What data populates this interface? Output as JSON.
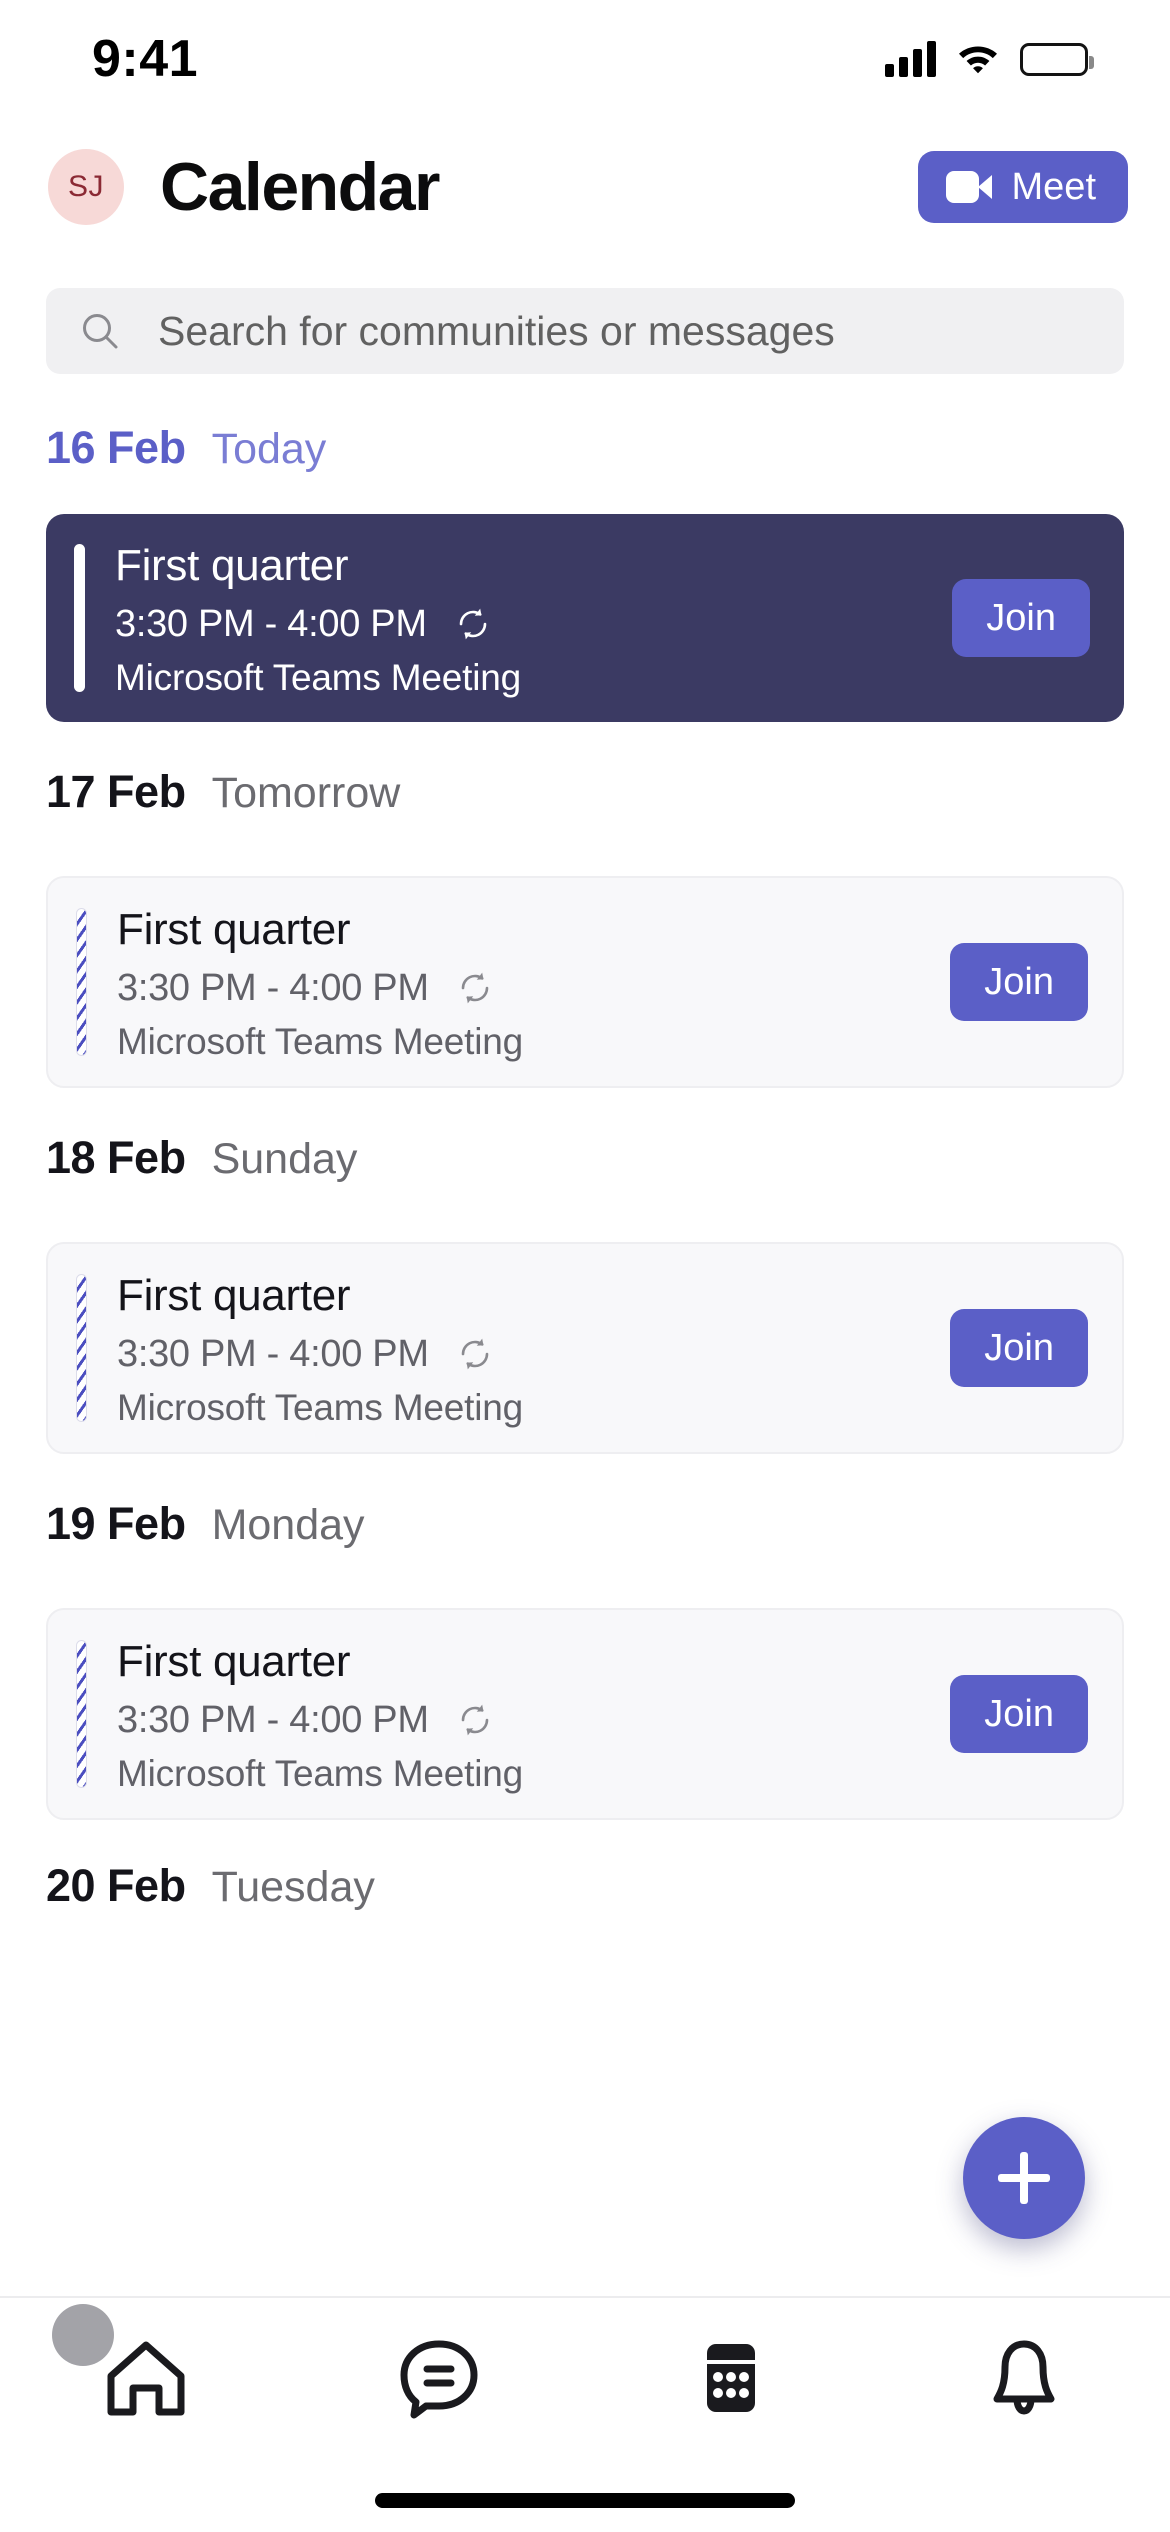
{
  "status_bar": {
    "time": "9:41",
    "signal_icon": "cellular-signal-icon",
    "wifi_icon": "wifi-icon",
    "battery_icon": "battery-full-icon"
  },
  "header": {
    "avatar_initials": "SJ",
    "title": "Calendar",
    "meet_button": {
      "label": "Meet",
      "icon": "video-camera-icon"
    }
  },
  "search": {
    "placeholder": "Search for communities or messages",
    "value": "",
    "icon": "search-icon"
  },
  "colors": {
    "accent": "#5B5FC7",
    "highlight_card_bg": "#3B3A63",
    "card_bg": "#F8F8FA",
    "today_text": "#5B5FC7",
    "muted_text": "#6B6B70",
    "avatar_bg": "#F7D9D7",
    "avatar_text": "#8B2A34"
  },
  "days": [
    {
      "date": "16 Feb",
      "relative": "Today",
      "is_today": true,
      "events": [
        {
          "title": "First quarter",
          "time": "3:30 PM - 4:00 PM",
          "subtitle": "Microsoft Teams Meeting",
          "recurring_icon": "recurring-icon",
          "join_label": "Join",
          "style": "highlight",
          "accent": "solid"
        }
      ]
    },
    {
      "date": "17 Feb",
      "relative": "Tomorrow",
      "is_today": false,
      "events": [
        {
          "title": "First quarter",
          "time": "3:30 PM - 4:00 PM",
          "subtitle": "Microsoft Teams Meeting",
          "recurring_icon": "recurring-icon",
          "join_label": "Join",
          "style": "normal",
          "accent": "striped"
        }
      ]
    },
    {
      "date": "18 Feb",
      "relative": "Sunday",
      "is_today": false,
      "events": [
        {
          "title": "First quarter",
          "time": "3:30 PM - 4:00 PM",
          "subtitle": "Microsoft Teams Meeting",
          "recurring_icon": "recurring-icon",
          "join_label": "Join",
          "style": "normal",
          "accent": "striped"
        }
      ]
    },
    {
      "date": "19 Feb",
      "relative": "Monday",
      "is_today": false,
      "events": [
        {
          "title": "First quarter",
          "time": "3:30 PM - 4:00 PM",
          "subtitle": "Microsoft Teams Meeting",
          "recurring_icon": "recurring-icon",
          "join_label": "Join",
          "style": "normal",
          "accent": "striped"
        }
      ]
    },
    {
      "date": "20 Feb",
      "relative": "Tuesday",
      "is_today": false,
      "events": []
    }
  ],
  "fab": {
    "icon": "plus-icon",
    "label": ""
  },
  "bottom_nav": {
    "items": [
      {
        "name": "home",
        "icon": "home-icon",
        "active": false,
        "badge": true
      },
      {
        "name": "chat",
        "icon": "chat-bubble-icon",
        "active": false,
        "badge": false
      },
      {
        "name": "calendar",
        "icon": "calendar-icon",
        "active": true,
        "badge": false
      },
      {
        "name": "activity",
        "icon": "bell-icon",
        "active": false,
        "badge": false
      }
    ]
  }
}
